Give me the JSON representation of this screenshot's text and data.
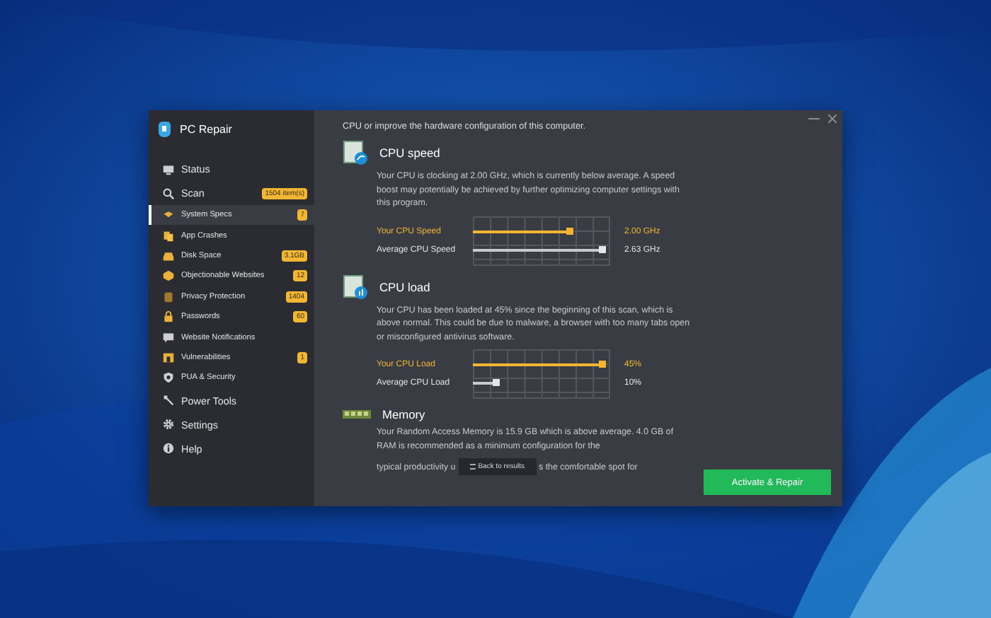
{
  "app": {
    "title": "PC Repair"
  },
  "sidebar": {
    "items": [
      {
        "kind": "main",
        "label": "Status",
        "selected": false
      },
      {
        "kind": "main",
        "label": "Scan",
        "badge": "1504 item(s)",
        "selected": false
      },
      {
        "kind": "sub",
        "label": "System Specs",
        "badge": "7",
        "selected": true
      },
      {
        "kind": "sub",
        "label": "App Crashes",
        "selected": false
      },
      {
        "kind": "sub",
        "label": "Disk Space",
        "badge": "3.1GB",
        "selected": false
      },
      {
        "kind": "sub",
        "label": "Objectionable Websites",
        "badge": "12",
        "selected": false
      },
      {
        "kind": "sub",
        "label": "Privacy Protection",
        "badge": "1404",
        "selected": false
      },
      {
        "kind": "sub",
        "label": "Passwords",
        "badge": "60",
        "selected": false
      },
      {
        "kind": "sub",
        "label": "Website Notifications",
        "selected": false
      },
      {
        "kind": "sub",
        "label": "Vulnerabilities",
        "badge": "1",
        "selected": false
      },
      {
        "kind": "sub",
        "label": "PUA & Security",
        "selected": false
      },
      {
        "kind": "main",
        "label": "Power Tools",
        "selected": false
      },
      {
        "kind": "main",
        "label": "Settings",
        "selected": false
      },
      {
        "kind": "main",
        "label": "Help",
        "selected": false
      }
    ]
  },
  "content": {
    "intro": "CPU or improve the hardware configuration of this computer.",
    "sections": [
      {
        "title": "CPU speed",
        "text": "Your CPU is clocking at 2.00 GHz, which is currently below average. A speed boost may potentially be achieved by further optimizing computer settings with this program.",
        "bars": [
          {
            "label": "Your CPU Speed",
            "highlight": true,
            "level": 0.73,
            "reading": "2.00 GHz"
          },
          {
            "label": "Average CPU Speed",
            "highlight": false,
            "level": 0.97,
            "reading": "2.63 GHz"
          }
        ]
      },
      {
        "title": "CPU load",
        "text": "Your CPU has been loaded at 45% since the beginning of this scan, which is above normal. This could be due to malware, a browser with too many tabs open or misconfigured antivirus software.",
        "bars": [
          {
            "label": "Your CPU Load",
            "highlight": true,
            "level": 0.97,
            "reading": "45%"
          },
          {
            "label": "Average CPU Load",
            "highlight": false,
            "level": 0.18,
            "reading": "10%"
          }
        ]
      },
      {
        "title": "Memory",
        "text": "Your Random Access Memory is 15.9 GB which is above average. 4.0 GB of RAM is recommended as a minimum configuration for the",
        "tail_before": "typical productivity u",
        "tail_after": "s the comfortable spot for"
      }
    ]
  },
  "tooltip": {
    "label": "Back to results"
  },
  "action_button": {
    "label": "Activate & Repair"
  }
}
